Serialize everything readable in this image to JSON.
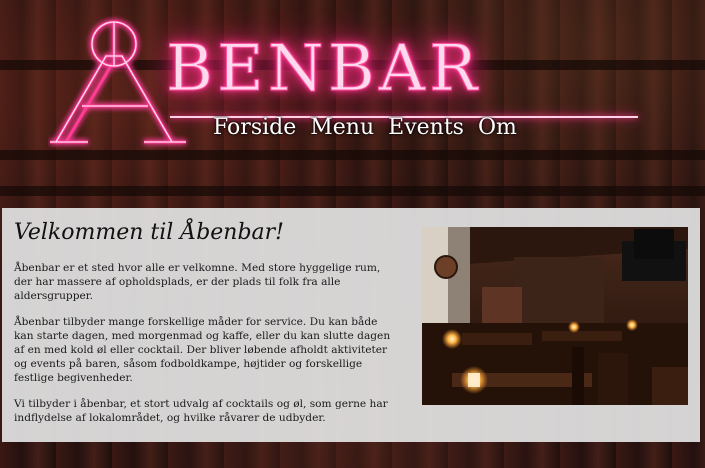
{
  "header": {
    "logo_text": "BENBAR",
    "logo_initial": "Å",
    "logo_alt": "Åbenbar"
  },
  "nav": {
    "items": [
      {
        "label": "Forside"
      },
      {
        "label": "Menu"
      },
      {
        "label": "Events"
      },
      {
        "label": "Om"
      }
    ]
  },
  "main": {
    "title": "Velkommen til Åbenbar!",
    "paragraphs": [
      "Åbenbar er et sted hvor alle er velkomne. Med store hyggelige rum, der har massere af opholdsplads, er der plads til folk fra alle aldersgrupper.",
      "Åbenbar tilbyder mange forskellige måder for service. Du kan både kan starte dagen, med morgenmad og kaffe, eller du kan slutte dagen af en med kold øl eller cocktail. Der bliver løbende afholdt aktiviteter og events på baren, såsom fodboldkampe, højtider og forskellige festlige begivenheder.",
      "Vi tilbyder i åbenbar, et stort udvalg af cocktails og øl, som gerne har indflydelse af lokalområdet, og hvilke råvarer de udbyder."
    ],
    "photo_icon": "bar-interior-photo"
  },
  "colors": {
    "neon": "#ff2f88",
    "panel": "#e2e2e2",
    "nav_text": "#ffffff"
  }
}
